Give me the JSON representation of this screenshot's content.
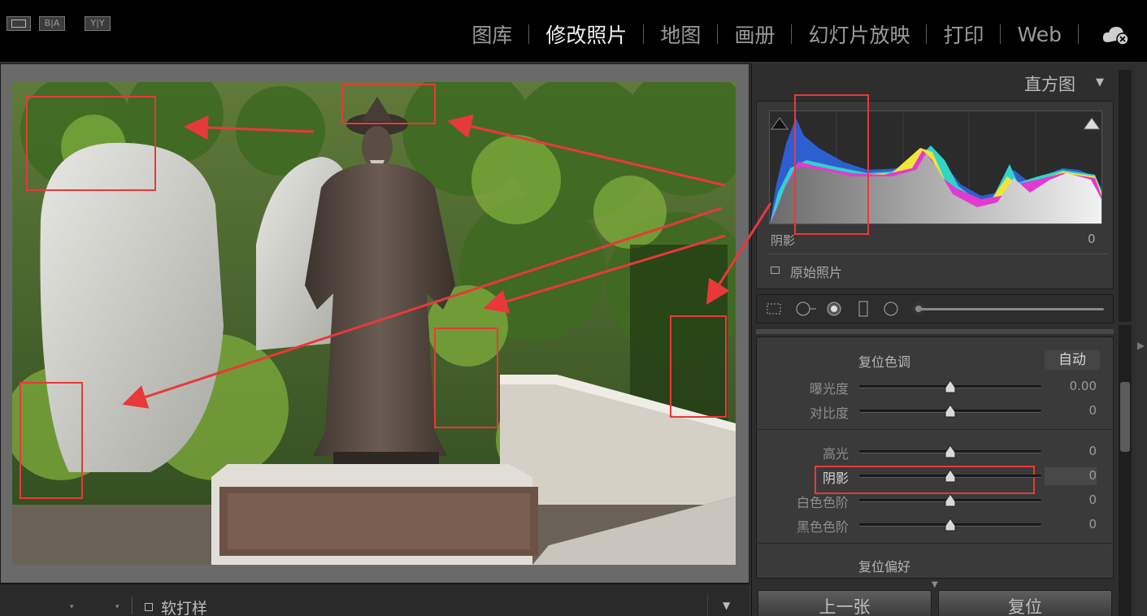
{
  "topbar": {
    "modules": [
      {
        "label": "图库",
        "active": false
      },
      {
        "label": "修改照片",
        "active": true
      },
      {
        "label": "地图",
        "active": false
      },
      {
        "label": "画册",
        "active": false
      },
      {
        "label": "幻灯片放映",
        "active": false
      },
      {
        "label": "打印",
        "active": false
      },
      {
        "label": "Web",
        "active": false
      }
    ],
    "cloud_icon": "cloud-sync-error-icon"
  },
  "histogram": {
    "title": "直方图",
    "readout_label": "阴影",
    "readout_value": "0",
    "original_photo_label": "原始照片"
  },
  "tone": {
    "reset_tone": "复位色调",
    "auto": "自动",
    "sliders": [
      {
        "label": "曝光度",
        "value": "0.00",
        "level": 0.5,
        "highlighted": false
      },
      {
        "label": "对比度",
        "value": "0",
        "level": 0.5,
        "highlighted": false
      },
      {
        "label": "高光",
        "value": "0",
        "level": 0.5,
        "highlighted": false
      },
      {
        "label": "阴影",
        "value": "0",
        "level": 0.5,
        "highlighted": true
      },
      {
        "label": "白色色阶",
        "value": "0",
        "level": 0.5,
        "highlighted": false
      },
      {
        "label": "黑色色阶",
        "value": "0",
        "level": 0.5,
        "highlighted": false
      }
    ],
    "reset_presence": "复位偏好"
  },
  "buttons": {
    "previous": "上一张",
    "reset": "复位"
  },
  "toolbar": {
    "view_ba": "B|A",
    "view_yy": "Y|Y",
    "soft_proof": "软打样"
  },
  "colors": {
    "annotation_red": "#e8393a",
    "background_dark": "#000000",
    "panel": "#3a3a3a"
  }
}
